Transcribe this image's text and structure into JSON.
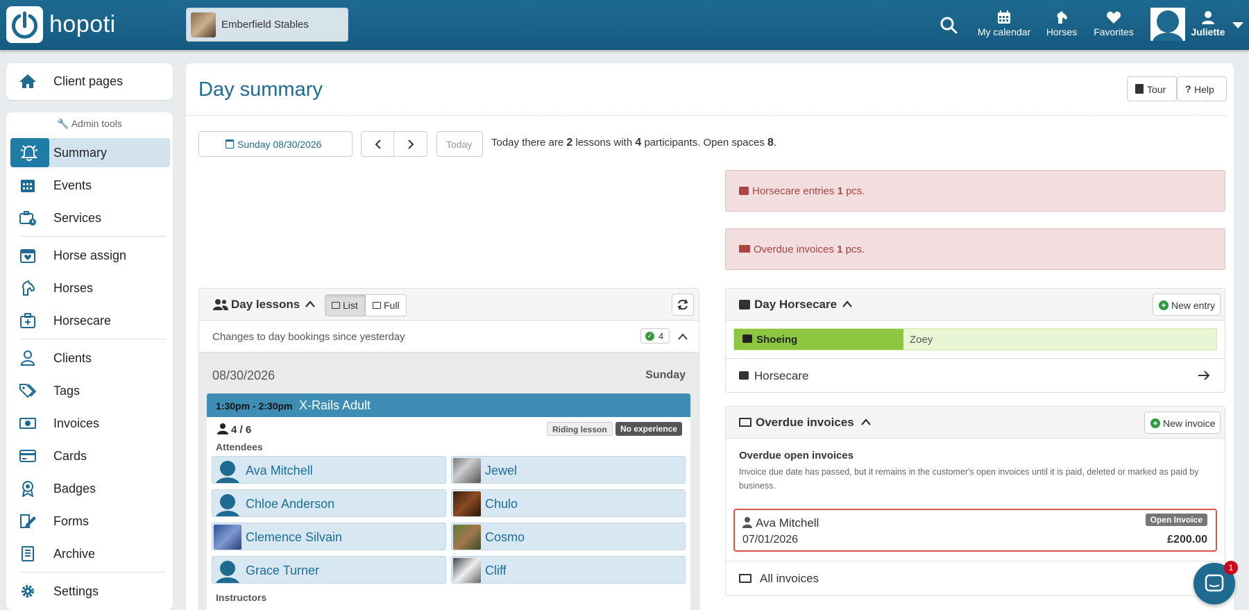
{
  "header": {
    "logo_text": "hopoti",
    "stable_name": "Emberfield Stables",
    "nav": [
      {
        "label": "My calendar",
        "icon": "calendar-icon"
      },
      {
        "label": "Horses",
        "icon": "horse-icon"
      },
      {
        "label": "Favorites",
        "icon": "heart-icon"
      }
    ],
    "user_name": "Juliette"
  },
  "sidebar": {
    "client_pages": "Client pages",
    "admin_tools": "Admin tools",
    "items": [
      {
        "label": "Summary",
        "icon": "bell-icon",
        "active": true
      },
      {
        "label": "Events",
        "icon": "calendar-icon"
      },
      {
        "label": "Services",
        "icon": "briefcase-clock-icon"
      },
      {
        "label": "Horse assign",
        "icon": "calendar-heart-icon"
      },
      {
        "label": "Horses",
        "icon": "horse-head-icon"
      },
      {
        "label": "Horsecare",
        "icon": "medkit-icon"
      },
      {
        "label": "Clients",
        "icon": "user-icon"
      },
      {
        "label": "Tags",
        "icon": "tags-icon"
      },
      {
        "label": "Invoices",
        "icon": "money-icon"
      },
      {
        "label": "Cards",
        "icon": "credit-card-icon"
      },
      {
        "label": "Badges",
        "icon": "award-icon"
      },
      {
        "label": "Forms",
        "icon": "form-edit-icon"
      },
      {
        "label": "Archive",
        "icon": "book-icon"
      },
      {
        "label": "Settings",
        "icon": "gear-icon"
      }
    ]
  },
  "page": {
    "title": "Day summary",
    "tour": "Tour",
    "help": "Help",
    "date_button": "Sunday 08/30/2026",
    "today_button": "Today",
    "summary": {
      "pre": "Today there are",
      "lessons": "2",
      "mid1": "lessons with",
      "participants": "4",
      "mid2": "participants. Open spaces",
      "spaces": "8",
      "end": "."
    }
  },
  "alerts": {
    "horsecare": {
      "pre": "Horsecare entries",
      "count": "1",
      "post": "pcs."
    },
    "invoices": {
      "pre": "Overdue invoices",
      "count": "1",
      "post": "pcs."
    }
  },
  "day_lessons": {
    "title": "Day lessons",
    "list_tab": "List",
    "full_tab": "Full",
    "changes_text": "Changes to day bookings since yesterday",
    "changes_count": "4",
    "date": "08/30/2026",
    "weekday": "Sunday",
    "lesson": {
      "time": "1:30pm - 2:30pm",
      "name": "X-Rails Adult",
      "participants": "4 / 6",
      "tag1": "Riding lesson",
      "tag2": "No experience",
      "attendees_label": "Attendees",
      "instructors_label": "Instructors",
      "attendees": [
        {
          "rider": "Ava Mitchell",
          "horse": "Jewel"
        },
        {
          "rider": "Chloe Anderson",
          "horse": "Chulo"
        },
        {
          "rider": "Clemence Silvain",
          "horse": "Cosmo"
        },
        {
          "rider": "Grace Turner",
          "horse": "Cliff"
        }
      ]
    }
  },
  "day_horsecare": {
    "title": "Day Horsecare",
    "new_entry": "New entry",
    "entry_type": "Shoeing",
    "entry_horse": "Zoey",
    "link_label": "Horsecare"
  },
  "overdue": {
    "title": "Overdue invoices",
    "new_invoice": "New invoice",
    "subtitle": "Overdue open invoices",
    "description": "Invoice due date has passed, but it remains in the customer's open invoices until it is paid, deleted or marked as paid by business.",
    "invoice": {
      "client": "Ava Mitchell",
      "date": "07/01/2026",
      "status": "Open Invoice",
      "amount": "£200.00"
    },
    "all_invoices": "All invoices"
  },
  "chat": {
    "badge": "1"
  },
  "colors": {
    "brand": "#1f6a91",
    "accent": "#1f7ca6",
    "danger": "#a94442",
    "success": "#8dc63f"
  }
}
